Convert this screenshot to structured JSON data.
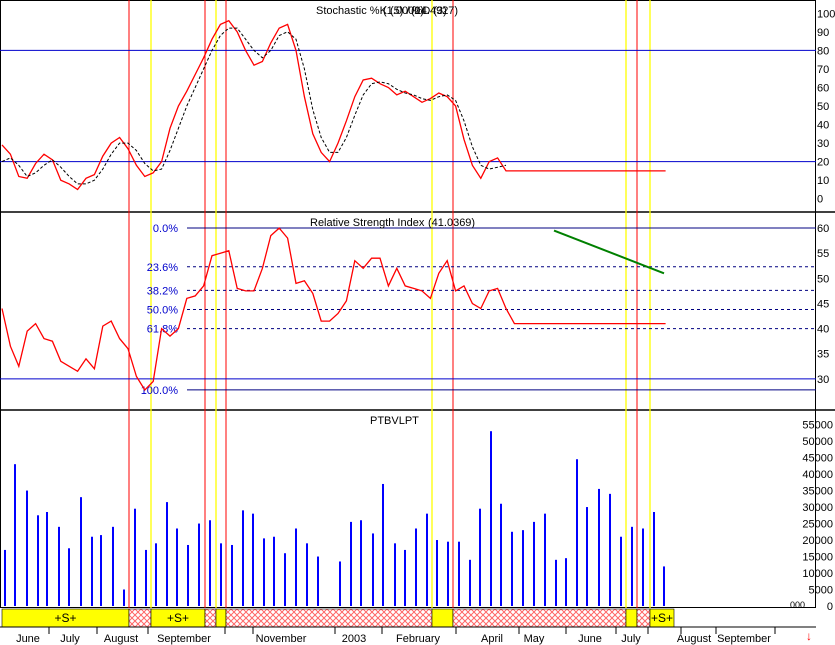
{
  "colors": {
    "background": "#ffffff",
    "k_line": "#ff0000",
    "d_line": "#000000",
    "rsi_line": "#ff0000",
    "fib_lines": "#000080",
    "volume_bars": "#0000ff",
    "trendline": "#008000",
    "red_markers": "#ff0000",
    "yellow_markers": "#ffff00",
    "signal_band_yellow": "#ffff00",
    "signal_band_hatch": "#ff6666"
  },
  "chart_data": [
    {
      "type": "line",
      "title": "Stochastic %K (5) / %D (3)",
      "title_overprint": "(1.0000)",
      "value_label": "(14.4927)",
      "ylim": [
        -5,
        105
      ],
      "yticks": [
        0,
        10,
        20,
        30,
        40,
        50,
        60,
        70,
        80,
        90,
        100
      ],
      "reference_lines": [
        20,
        80
      ],
      "series": [
        {
          "style": "solid",
          "x": [
            0,
            2,
            4,
            6,
            8,
            10,
            12,
            14,
            16,
            18,
            20,
            22,
            24,
            26,
            28,
            30,
            32,
            34,
            36,
            38,
            40,
            42,
            44,
            46,
            48,
            50,
            52,
            54,
            56,
            58,
            60,
            62,
            64,
            66,
            68,
            70,
            72,
            74,
            76,
            78,
            80,
            82,
            84,
            86,
            88,
            90,
            92,
            94,
            96,
            98,
            100,
            102,
            104,
            106,
            108,
            110,
            112,
            114,
            116,
            118,
            120,
            122,
            124,
            126,
            128,
            130,
            132,
            134,
            136,
            138,
            140,
            142,
            144,
            146,
            148,
            150,
            152,
            154,
            156,
            158
          ],
          "values": [
            29,
            24,
            12,
            11,
            19,
            24,
            21,
            10,
            8,
            5,
            11,
            13,
            23,
            30,
            33,
            27,
            18,
            12,
            14,
            20,
            38,
            50,
            58,
            67,
            76,
            86,
            94,
            96,
            90,
            80,
            72,
            74,
            84,
            92,
            94,
            80,
            55,
            35,
            25,
            20,
            30,
            42,
            55,
            64,
            65,
            62,
            60,
            56,
            58,
            55,
            52,
            54,
            57,
            55,
            50,
            32,
            18,
            11,
            20,
            22,
            15,
            15,
            15,
            15,
            15,
            15,
            15,
            15,
            15,
            15,
            15,
            15,
            15,
            15,
            15,
            15,
            15,
            15,
            15,
            15
          ]
        },
        {
          "style": "dashed",
          "x": [
            0,
            2,
            4,
            6,
            8,
            10,
            12,
            14,
            16,
            18,
            20,
            22,
            24,
            26,
            28,
            30,
            32,
            34,
            36,
            38,
            40,
            42,
            44,
            46,
            48,
            50,
            52,
            54,
            56,
            58,
            60,
            62,
            64,
            66,
            68,
            70,
            72,
            74,
            76,
            78,
            80,
            82,
            84,
            86,
            88,
            90,
            92,
            94,
            96,
            98,
            100,
            102,
            104,
            106,
            108,
            110,
            112,
            114,
            116,
            118,
            120
          ],
          "values": [
            20,
            22,
            18,
            12,
            14,
            18,
            21,
            17,
            12,
            8,
            8,
            10,
            16,
            24,
            30,
            30,
            26,
            19,
            15,
            16,
            26,
            38,
            50,
            60,
            70,
            80,
            88,
            92,
            92,
            86,
            80,
            76,
            80,
            88,
            90,
            86,
            70,
            48,
            33,
            25,
            25,
            33,
            45,
            56,
            62,
            63,
            62,
            59,
            57,
            56,
            54,
            53,
            55,
            56,
            53,
            42,
            28,
            18,
            16,
            17,
            18
          ]
        }
      ]
    },
    {
      "type": "line",
      "title": "Relative Strength Index",
      "value_label": "(41.0369)",
      "ylim": [
        25,
        62
      ],
      "yticks": [
        30,
        35,
        40,
        45,
        50,
        55,
        60
      ],
      "reference_lines": [
        30
      ],
      "fib_levels": [
        {
          "label": "0.0%",
          "value": 60
        },
        {
          "label": "23.6%",
          "value": 52.3
        },
        {
          "label": "38.2%",
          "value": 47.6
        },
        {
          "label": "50.0%",
          "value": 43.8
        },
        {
          "label": "61.8%",
          "value": 40
        },
        {
          "label": "100.0%",
          "value": 27.8
        }
      ],
      "trendline": {
        "from": [
          554,
          59.5
        ],
        "to": [
          664,
          51
        ]
      },
      "series": [
        {
          "x": [
            0,
            2,
            4,
            6,
            8,
            10,
            12,
            14,
            16,
            18,
            20,
            22,
            24,
            26,
            28,
            30,
            32,
            34,
            36,
            38,
            40,
            42,
            44,
            46,
            48,
            50,
            52,
            54,
            56,
            58,
            60,
            62,
            64,
            66,
            68,
            70,
            72,
            74,
            76,
            78,
            80,
            82,
            84,
            86,
            88,
            90,
            92,
            94,
            96,
            98,
            100,
            102,
            104,
            106,
            108,
            110,
            112,
            114,
            116,
            118,
            120,
            122,
            124,
            126,
            128,
            130,
            132,
            134,
            136,
            138,
            140,
            142,
            144,
            146,
            148,
            150,
            152,
            154,
            156,
            158
          ],
          "values": [
            44,
            36.5,
            32.5,
            39.5,
            41,
            38,
            37.5,
            33.5,
            32.5,
            31.5,
            34,
            32,
            40.5,
            41.5,
            38,
            36,
            30.5,
            27.8,
            29.5,
            40,
            38.5,
            40,
            46,
            46.5,
            48.5,
            54.5,
            55,
            55.5,
            48,
            47.5,
            47.5,
            52,
            58.5,
            60,
            58,
            49,
            49.5,
            47,
            41.5,
            41.5,
            43,
            45.5,
            53.5,
            52,
            54,
            54,
            48.5,
            52,
            48.5,
            48,
            47.5,
            46,
            51,
            53.5,
            47.5,
            48.5,
            45,
            44,
            47.5,
            48,
            44,
            41,
            41,
            41,
            41,
            41,
            41,
            41,
            41,
            41,
            41,
            41,
            41,
            41,
            41,
            41,
            41,
            41,
            41,
            41
          ]
        }
      ]
    },
    {
      "type": "bar",
      "title": "PTBVLPT",
      "ylim": [
        0,
        57000
      ],
      "yticks": [
        0,
        5000,
        10000,
        15000,
        20000,
        25000,
        30000,
        35000,
        40000,
        45000,
        50000,
        55000
      ],
      "x": [
        5,
        15,
        27,
        38,
        47,
        59,
        69,
        81,
        92,
        101,
        113,
        124,
        135,
        146,
        156,
        167,
        177,
        188,
        199,
        210,
        221,
        232,
        243,
        253,
        264,
        274,
        285,
        296,
        307,
        318,
        340,
        351,
        361,
        373,
        383,
        395,
        405,
        416,
        427,
        437,
        448,
        459,
        470,
        480,
        491,
        501,
        512,
        523,
        534,
        545,
        556,
        566,
        577,
        587,
        599,
        610,
        621,
        632,
        643,
        654,
        664
      ],
      "values": [
        17000,
        43000,
        35000,
        27500,
        28500,
        24000,
        17500,
        33000,
        21000,
        21500,
        24000,
        5000,
        29500,
        17000,
        19000,
        31500,
        23500,
        18500,
        25000,
        26000,
        19000,
        18500,
        29000,
        28000,
        20500,
        21000,
        16000,
        23500,
        19000,
        15000,
        13500,
        25500,
        26000,
        22000,
        37000,
        19000,
        17000,
        23500,
        28000,
        20000,
        19500,
        19500,
        14000,
        29500,
        53000,
        31000,
        22500,
        23000,
        25500,
        28000,
        14000,
        14500,
        44500,
        30000,
        35500,
        34000,
        21000,
        24000,
        23500,
        28500,
        12000
      ]
    }
  ],
  "volume_axis_stray_label": "000",
  "markers": {
    "red_x": [
      129,
      205,
      226,
      453,
      637
    ],
    "yellow_x": [
      151,
      216,
      432,
      626,
      650
    ]
  },
  "signal_band": {
    "segments": [
      {
        "style": "yellow",
        "from": 2,
        "to": 129,
        "label": "+S+"
      },
      {
        "style": "hatch",
        "from": 129,
        "to": 151,
        "label": ""
      },
      {
        "style": "yellow",
        "from": 151,
        "to": 205,
        "label": "+S+"
      },
      {
        "style": "hatch",
        "from": 205,
        "to": 216,
        "label": ""
      },
      {
        "style": "yellow",
        "from": 216,
        "to": 226,
        "label": ""
      },
      {
        "style": "hatch",
        "from": 226,
        "to": 432,
        "label": ""
      },
      {
        "style": "yellow",
        "from": 432,
        "to": 453,
        "label": ""
      },
      {
        "style": "hatch",
        "from": 453,
        "to": 626,
        "label": ""
      },
      {
        "style": "yellow",
        "from": 626,
        "to": 637,
        "label": ""
      },
      {
        "style": "hatch",
        "from": 637,
        "to": 650,
        "label": ""
      },
      {
        "style": "yellow",
        "from": 650,
        "to": 674,
        "label": "+S+"
      }
    ]
  },
  "x_axis": {
    "months": [
      {
        "label": "June",
        "x": 28
      },
      {
        "label": "July",
        "x": 70
      },
      {
        "label": "August",
        "x": 121
      },
      {
        "label": "September",
        "x": 184
      },
      {
        "label": "November",
        "x": 281
      },
      {
        "label": "2003",
        "x": 354
      },
      {
        "label": "February",
        "x": 418
      },
      {
        "label": "April",
        "x": 492
      },
      {
        "label": "May",
        "x": 534
      },
      {
        "label": "June",
        "x": 590
      },
      {
        "label": "July",
        "x": 631
      },
      {
        "label": "August",
        "x": 694
      },
      {
        "label": "September",
        "x": 744
      }
    ],
    "tick_x": [
      49,
      97,
      148,
      225,
      253,
      335,
      382,
      456,
      519,
      566,
      616,
      648,
      681,
      716,
      775
    ]
  },
  "scroll_arrow": "↓"
}
